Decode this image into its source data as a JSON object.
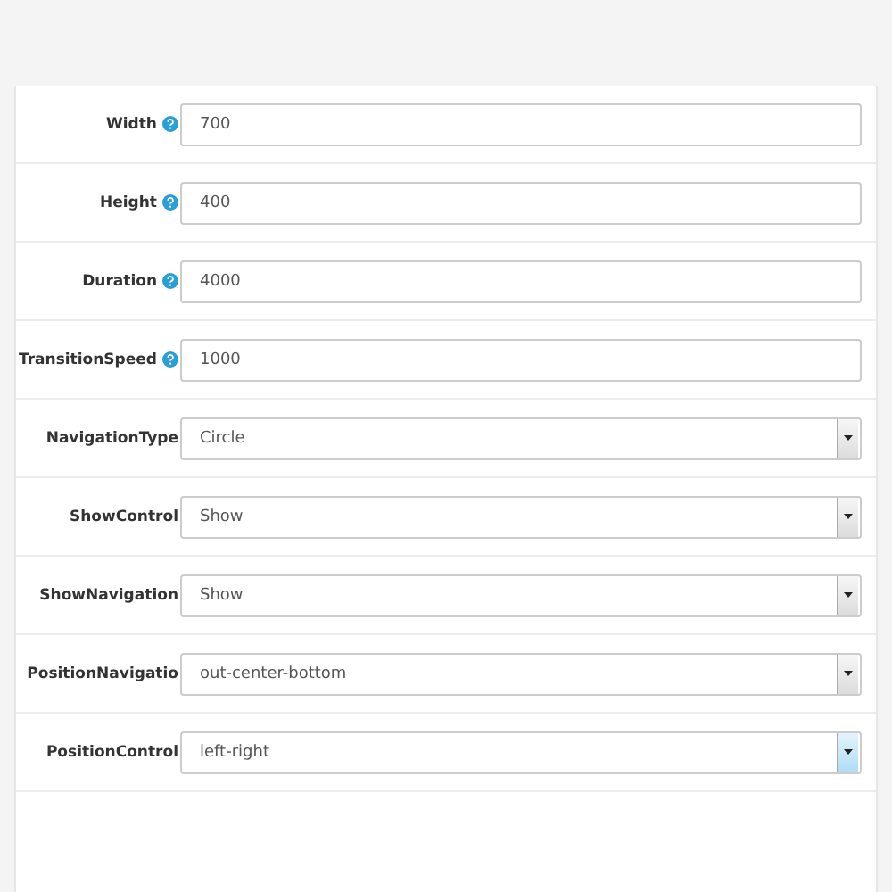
{
  "fields": [
    {
      "label": "Width",
      "help": true,
      "kind": "text",
      "value": "700"
    },
    {
      "label": "Height",
      "help": true,
      "kind": "text",
      "value": "400"
    },
    {
      "label": "Duration",
      "help": true,
      "kind": "text",
      "value": "4000"
    },
    {
      "label": "TransitionSpeed",
      "help": true,
      "kind": "text",
      "value": "1000"
    },
    {
      "label": "NavigationType",
      "help": false,
      "kind": "select",
      "value": "Circle",
      "focused": false
    },
    {
      "label": "ShowControl",
      "help": false,
      "kind": "select",
      "value": "Show",
      "focused": false
    },
    {
      "label": "ShowNavigation",
      "help": false,
      "kind": "select",
      "value": "Show",
      "focused": false
    },
    {
      "label": "PositionNavigatio",
      "help": false,
      "kind": "select",
      "value": "out-center-bottom",
      "focused": false
    },
    {
      "label": "PositionControl",
      "help": false,
      "kind": "select",
      "value": "left-right",
      "focused": true
    }
  ]
}
